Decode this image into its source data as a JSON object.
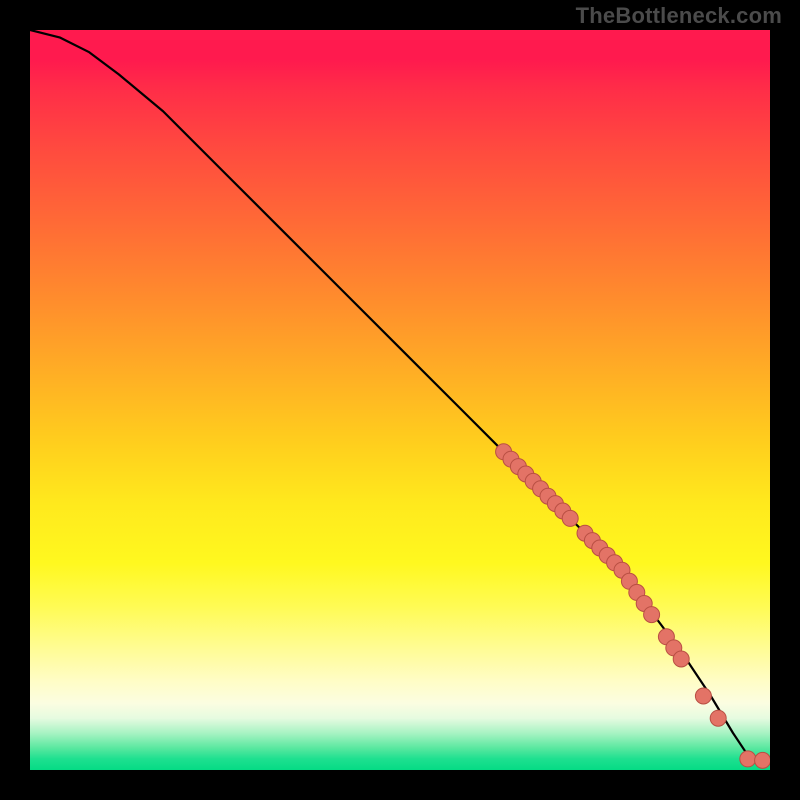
{
  "watermark": "TheBottleneck.com",
  "colors": {
    "page_bg": "#000000",
    "line": "#000000",
    "marker_fill": "#e37366",
    "marker_stroke": "#b94f43",
    "watermark_text": "#4b4b4b"
  },
  "chart_data": {
    "type": "line",
    "title": "",
    "xlabel": "",
    "ylabel": "",
    "xlim": [
      0,
      100
    ],
    "ylim": [
      0,
      100
    ],
    "grid": false,
    "legend": false,
    "line_series": {
      "name": "curve",
      "x": [
        0,
        4,
        8,
        12,
        18,
        26,
        34,
        42,
        50,
        58,
        64,
        70,
        76,
        82,
        88,
        92,
        95,
        97,
        99,
        100
      ],
      "y": [
        100,
        99,
        97,
        94,
        89,
        81,
        73,
        65,
        57,
        49,
        43,
        37,
        31,
        24,
        16,
        10,
        5,
        2,
        1.2,
        1.2
      ]
    },
    "scatter_series": {
      "name": "points",
      "x": [
        64,
        65,
        66,
        67,
        68,
        69,
        70,
        71,
        72,
        73,
        75,
        76,
        77,
        78,
        79,
        80,
        81,
        82,
        83,
        84,
        86,
        87,
        88,
        91,
        93,
        97,
        99
      ],
      "y": [
        43,
        42,
        41,
        40,
        39,
        38,
        37,
        36,
        35,
        34,
        32,
        31,
        30,
        29,
        28,
        27,
        25.5,
        24,
        22.5,
        21,
        18,
        16.5,
        15,
        10,
        7,
        1.5,
        1.3
      ]
    }
  }
}
